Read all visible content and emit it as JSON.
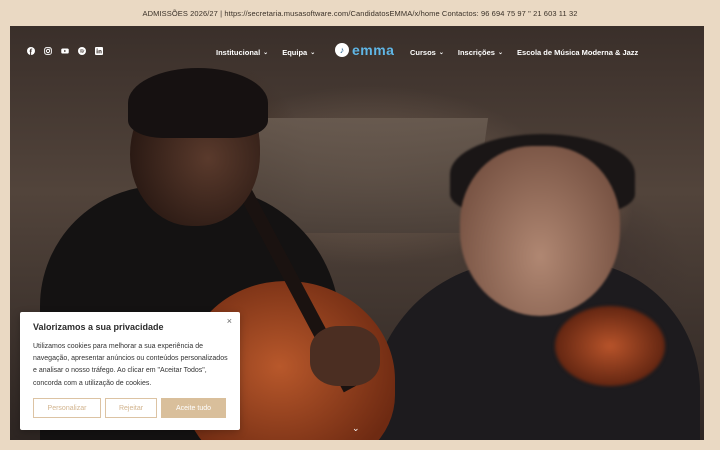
{
  "announcement": "ADMISSÕES 2026/27 | https://secretaria.musasoftware.com/CandidatosEMMA/x/home Contactos: 96 694 75 97 \" 21 603 11 32",
  "social_icons": [
    "facebook-icon",
    "instagram-icon",
    "youtube-icon",
    "spotify-icon",
    "linkedin-icon"
  ],
  "nav": {
    "left": [
      {
        "label": "Institucional",
        "dropdown": true
      },
      {
        "label": "Equipa",
        "dropdown": true
      }
    ],
    "logo": "emma",
    "right": [
      {
        "label": "Cursos",
        "dropdown": true
      },
      {
        "label": "Inscrições",
        "dropdown": true
      },
      {
        "label": "Escola de Música Moderna & Jazz",
        "dropdown": false
      }
    ]
  },
  "cookie": {
    "title": "Valorizamos a sua privacidade",
    "text": "Utilizamos cookies para melhorar a sua experiência de navegação, apresentar anúncios ou conteúdos personalizados e analisar o nosso tráfego. Ao clicar em \"Aceitar Todos\", concorda com a utilização de cookies.",
    "close": "×",
    "buttons": {
      "customize": "Personalizar",
      "reject": "Rejeitar",
      "accept": "Aceite tudo"
    }
  },
  "scroll_down": "⌄",
  "colors": {
    "accent": "#d9bf9b",
    "logo_blue": "#5fb6e6",
    "topbar_bg": "#ead9c3"
  }
}
